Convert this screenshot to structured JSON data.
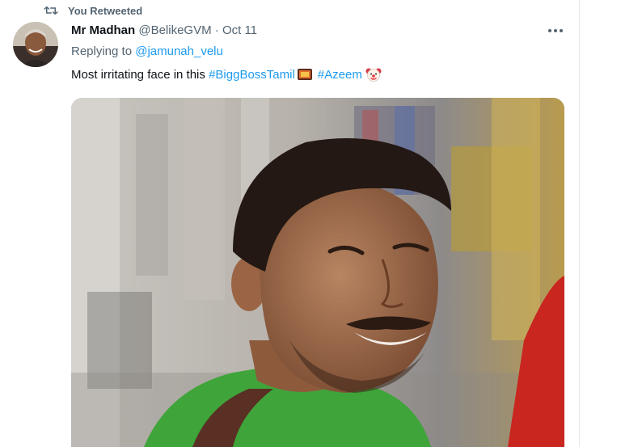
{
  "retweet": {
    "label": "You Retweeted",
    "icon": "retweet-icon"
  },
  "author": {
    "name": "Mr Madhan",
    "handle": "@BelikeGVM",
    "separator": "·",
    "date": "Oct 11"
  },
  "reply": {
    "prefix": "Replying to",
    "mention": "@jamunah_velu"
  },
  "tweet": {
    "text": "Most irritating face in this",
    "hashtags": [
      "#BiggBossTamil",
      "#Azeem"
    ],
    "emojis": [
      "bigg-boss-tv-emoji",
      "clown-face-emoji"
    ]
  },
  "media": {
    "type": "photo"
  },
  "colors": {
    "link": "#1d9bf0",
    "secondary_text": "#536471",
    "primary_text": "#0f1419"
  }
}
